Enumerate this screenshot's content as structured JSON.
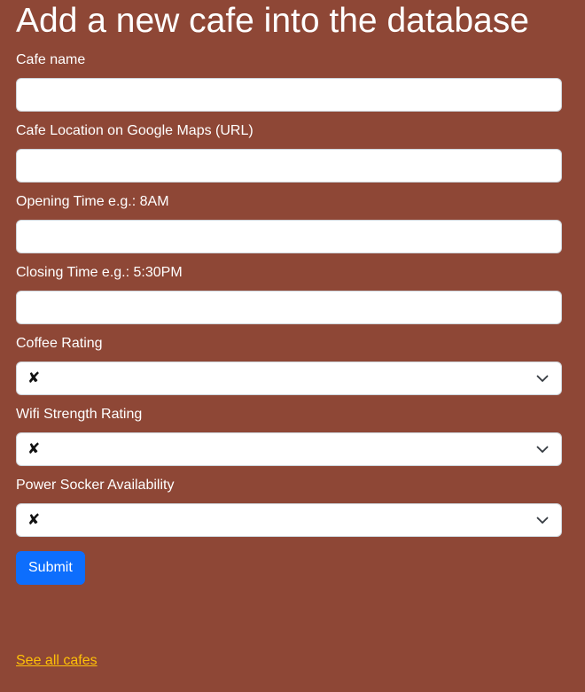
{
  "page": {
    "title": "Add a new cafe into the database"
  },
  "form": {
    "fields": [
      {
        "label": "Cafe name",
        "value": ""
      },
      {
        "label": "Cafe Location on Google Maps (URL)",
        "value": ""
      },
      {
        "label": "Opening Time e.g.: 8AM",
        "value": ""
      },
      {
        "label": "Closing Time e.g.: 5:30PM",
        "value": ""
      }
    ],
    "selects": [
      {
        "label": "Coffee Rating",
        "selected": "✘"
      },
      {
        "label": "Wifi Strength Rating",
        "selected": "✘"
      },
      {
        "label": "Power Socker Availability",
        "selected": "✘"
      }
    ],
    "submit_label": "Submit"
  },
  "footer": {
    "link_label": "See all cafes"
  },
  "colors": {
    "background": "#8e4736",
    "submit": "#0d6efd",
    "link": "#ffc107"
  },
  "icons": {
    "select_arrow": "chevron-down-icon"
  }
}
